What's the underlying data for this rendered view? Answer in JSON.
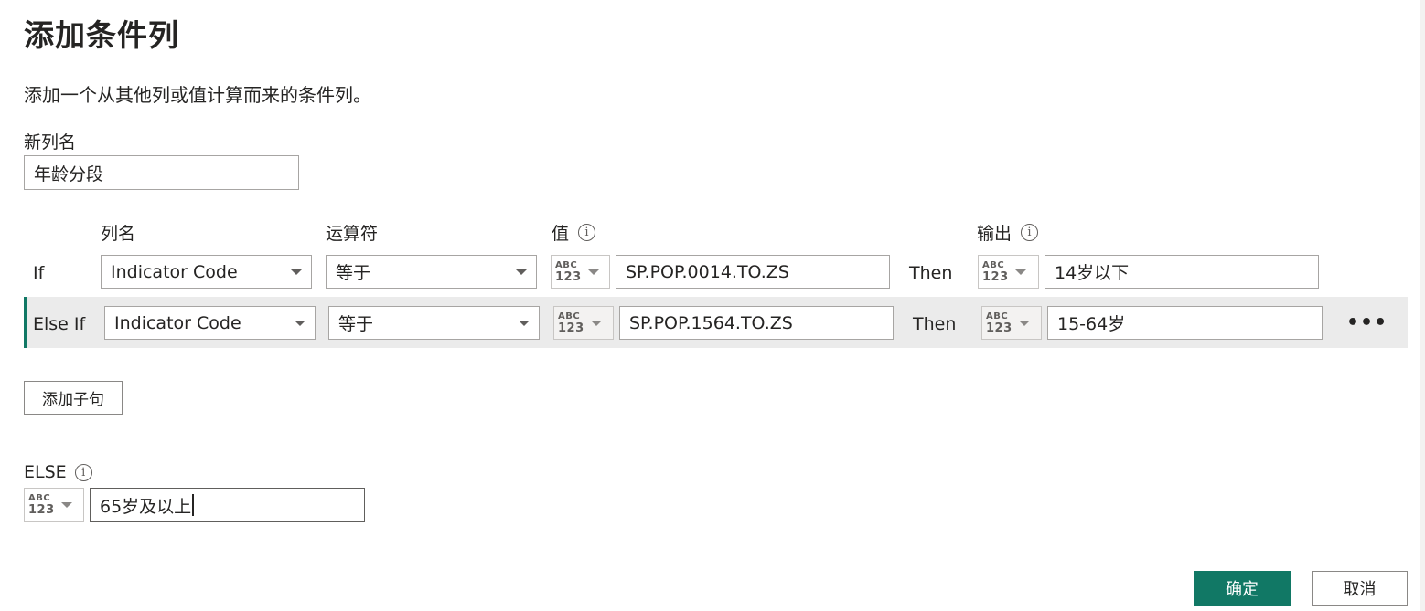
{
  "dialog": {
    "title": "添加条件列",
    "subtitle": "添加一个从其他列或值计算而来的条件列。"
  },
  "new_column": {
    "label": "新列名",
    "value": "年龄分段"
  },
  "headers": {
    "column_name": "列名",
    "operator": "运算符",
    "value": "值",
    "output": "输出"
  },
  "type_icon": {
    "line1": "ABC",
    "line2": "123"
  },
  "clauses": [
    {
      "keyword": "If",
      "column": "Indicator Code",
      "operator": "等于",
      "value": "SP.POP.0014.TO.ZS",
      "then": "Then",
      "output": "14岁以下"
    },
    {
      "keyword": "Else If",
      "column": "Indicator Code",
      "operator": "等于",
      "value": "SP.POP.1564.TO.ZS",
      "then": "Then",
      "output": "15-64岁"
    }
  ],
  "more_label": "•••",
  "add_clause_label": "添加子句",
  "else": {
    "label": "ELSE",
    "value": "65岁及以上"
  },
  "buttons": {
    "ok": "确定",
    "cancel": "取消"
  },
  "colors": {
    "accent": "#117865",
    "selected_row_bg": "#ebebeb"
  },
  "icons": {
    "info": "info-icon",
    "dropdown": "chevron-down-icon",
    "type": "abc-123-type-icon",
    "more": "more-options-icon"
  }
}
